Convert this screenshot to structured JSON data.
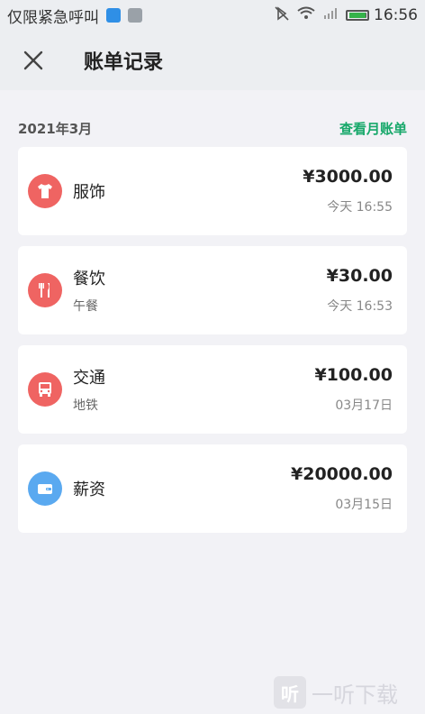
{
  "statusbar": {
    "left_text": "仅限紧急呼叫",
    "time": "16:56"
  },
  "header": {
    "title": "账单记录"
  },
  "month": {
    "label": "2021年3月",
    "link": "查看月账单"
  },
  "transactions": [
    {
      "category": "服饰",
      "subtitle": "",
      "amount": "¥3000.00",
      "time": "今天 16:55",
      "icon": "shirt-icon",
      "color": "#ef6462"
    },
    {
      "category": "餐饮",
      "subtitle": "午餐",
      "amount": "¥30.00",
      "time": "今天 16:53",
      "icon": "fork-knife-icon",
      "color": "#ef6462"
    },
    {
      "category": "交通",
      "subtitle": "地铁",
      "amount": "¥100.00",
      "time": "03月17日",
      "icon": "bus-icon",
      "color": "#ef6462"
    },
    {
      "category": "薪资",
      "subtitle": "",
      "amount": "¥20000.00",
      "time": "03月15日",
      "icon": "wallet-icon",
      "color": "#5aa9f0"
    }
  ],
  "watermark": {
    "text": "一听下载",
    "logo": "听"
  }
}
